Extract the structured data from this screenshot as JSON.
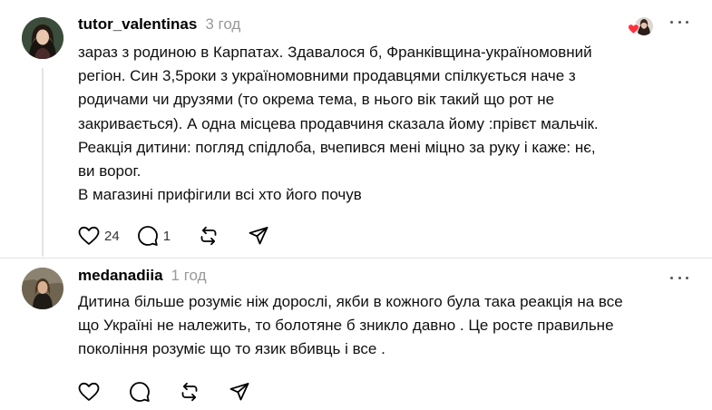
{
  "comments": [
    {
      "username": "tutor_valentinas",
      "time": "3 год",
      "liked_by_author": true,
      "lines": [
        "зараз з родиною в Карпатах. Здавалося б, Франківщина-україномовний",
        "регіон. Син 3,5роки з україномовними продавцями спілкується наче з",
        "родичами чи друзями (то окрема тема, в нього вік такий що рот не",
        "закривається). А одна місцева продавчиня сказала йому :прівєт мальчік.",
        "Реакція дитини: погляд спідлоба, вчепився мені міцно за руку і каже: нє,",
        "ви ворог.",
        "В магазині прифігили всі хто його почув"
      ],
      "likes": "24",
      "replies": "1"
    },
    {
      "username": "medanadiia",
      "time": "1 год",
      "lines": [
        "Дитина більше розуміє ніж дорослі, якби в кожного була така реакція на все",
        "що Україні не належить, то болотяне б зникло давно . Це росте правильне",
        "покоління розуміє що то язик вбивць і все ."
      ]
    }
  ],
  "icons": {
    "like": "heart-icon",
    "reply": "speech-bubble-icon",
    "repost": "repost-icon",
    "share": "send-icon",
    "more": "more-dots-icon",
    "liked_by": "red-heart-icon"
  },
  "colors": {
    "liked_heart": "#ff3040",
    "secondary_text": "#999999",
    "divider": "#e2e2e2"
  }
}
